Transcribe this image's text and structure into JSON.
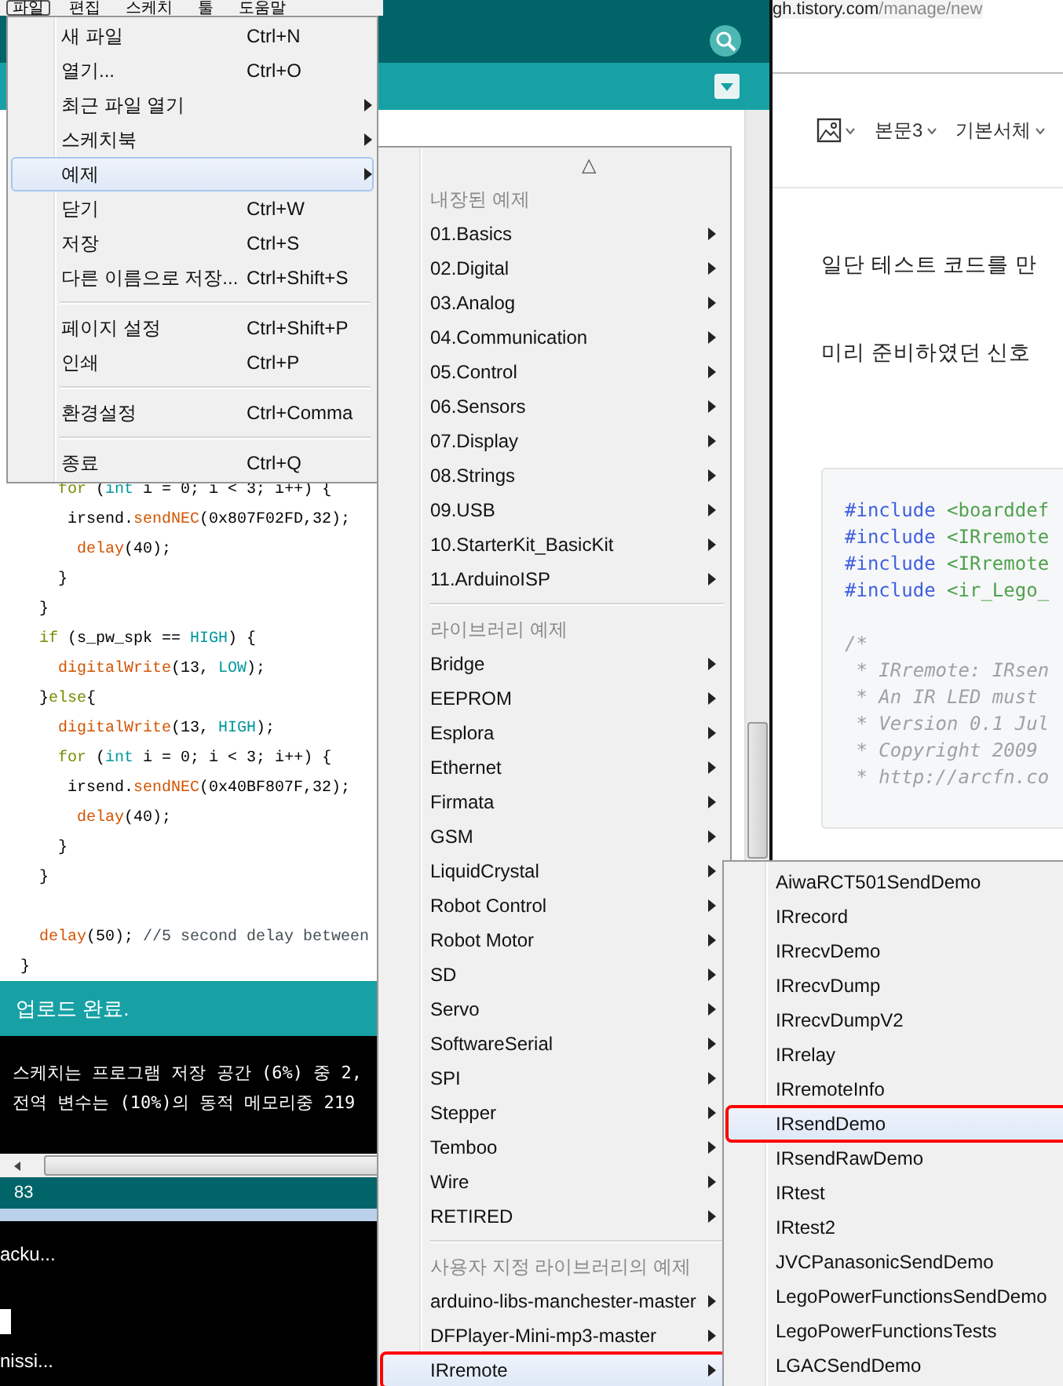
{
  "ide": {
    "menubar": [
      {
        "label": "파일",
        "selected": true
      },
      {
        "label": "편집",
        "selected": false
      },
      {
        "label": "스케치",
        "selected": false
      },
      {
        "label": "툴",
        "selected": false
      },
      {
        "label": "도움말",
        "selected": false
      }
    ],
    "code_blocks": [
      [
        [
          {
            "text": "    for",
            "kind": "keyword"
          },
          {
            "text": " ("
          },
          {
            "text": "int",
            "kind": "constant"
          },
          {
            "text": " i = 0; i < 3; i++) {"
          }
        ],
        [
          {
            "text": "     irsend."
          },
          {
            "text": "sendNEC",
            "kind": "function"
          },
          {
            "text": "(0x807F02FD,32);"
          }
        ],
        [
          {
            "text": "      delay",
            "kind": "function"
          },
          {
            "text": "(40);"
          }
        ],
        [
          {
            "text": "    }"
          }
        ],
        [
          {
            "text": "  }"
          }
        ],
        [
          {
            "text": "  if",
            "kind": "keyword"
          },
          {
            "text": " (s_pw_spk == "
          },
          {
            "text": "HIGH",
            "kind": "constant"
          },
          {
            "text": ") {"
          }
        ],
        [
          {
            "text": "    digitalWrite",
            "kind": "function"
          },
          {
            "text": "(13, "
          },
          {
            "text": "LOW",
            "kind": "constant"
          },
          {
            "text": ");"
          }
        ],
        [
          {
            "text": "  }"
          },
          {
            "text": "else",
            "kind": "keyword"
          },
          {
            "text": "{"
          }
        ],
        [
          {
            "text": "    digitalWrite",
            "kind": "function"
          },
          {
            "text": "(13, "
          },
          {
            "text": "HIGH",
            "kind": "constant"
          },
          {
            "text": ");"
          }
        ],
        [
          {
            "text": "    for",
            "kind": "keyword"
          },
          {
            "text": " ("
          },
          {
            "text": "int",
            "kind": "constant"
          },
          {
            "text": " i = 0; i < 3; i++) {"
          }
        ],
        [
          {
            "text": "     irsend."
          },
          {
            "text": "sendNEC",
            "kind": "function"
          },
          {
            "text": "(0x40BF807F,32);"
          }
        ],
        [
          {
            "text": "      delay",
            "kind": "function"
          },
          {
            "text": "(40);"
          }
        ],
        [
          {
            "text": "    }"
          }
        ],
        [
          {
            "text": "  }"
          }
        ]
      ],
      [
        [
          {
            "text": "  delay",
            "kind": "function"
          },
          {
            "text": "(50); "
          },
          {
            "text": "//5 second delay between",
            "kind": "comment"
          }
        ],
        [
          {
            "text": "}"
          }
        ]
      ]
    ],
    "status": "업로드 완료.",
    "console": [
      "스케치는 프로그램 저장 공간 (6%) 중 2,",
      "전역 변수는 (10%)의 동적 메모리중 219"
    ],
    "line_number": "83"
  },
  "terminal": {
    "lines": [
      "acku...",
      "nissi..."
    ]
  },
  "browser": {
    "url_host": "gh.tistory.com",
    "url_path": "/manage/new",
    "toolbar": [
      {
        "kind": "image"
      },
      {
        "kind": "dropdown",
        "label": "본문3"
      },
      {
        "kind": "dropdown",
        "label": "기본서체"
      }
    ],
    "paragraphs": [
      "일단 테스트 코드를 만",
      "미리 준비하였던 신호"
    ],
    "code_blocks": [
      [
        [
          {
            "text": "#include",
            "kind": "directive"
          },
          {
            "text": " <boarddef",
            "kind": "string"
          }
        ],
        [
          {
            "text": "#include",
            "kind": "directive"
          },
          {
            "text": " <IRremote",
            "kind": "string"
          }
        ],
        [
          {
            "text": "#include",
            "kind": "directive"
          },
          {
            "text": " <IRremote",
            "kind": "string"
          }
        ],
        [
          {
            "text": "#include",
            "kind": "directive"
          },
          {
            "text": " <ir_Lego_",
            "kind": "string"
          }
        ]
      ],
      [
        [
          {
            "text": "/*",
            "kind": "comment"
          }
        ],
        [
          {
            "text": " * IRremote: IRsen",
            "kind": "comment"
          }
        ],
        [
          {
            "text": " * An IR LED must",
            "kind": "comment"
          }
        ],
        [
          {
            "text": " * Version 0.1 Jul",
            "kind": "comment"
          }
        ],
        [
          {
            "text": " * Copyright 2009",
            "kind": "comment"
          }
        ],
        [
          {
            "text": " * http://arcfn.co",
            "kind": "comment"
          }
        ]
      ]
    ]
  },
  "file_menu": [
    {
      "kind": "item",
      "label": "새 파일",
      "shortcut": "Ctrl+N",
      "submenu": false,
      "selected": false
    },
    {
      "kind": "item",
      "label": "열기...",
      "shortcut": "Ctrl+O",
      "submenu": false,
      "selected": false
    },
    {
      "kind": "item",
      "label": "최근 파일 열기",
      "submenu": true,
      "selected": false
    },
    {
      "kind": "item",
      "label": "스케치북",
      "submenu": true,
      "selected": false
    },
    {
      "kind": "item",
      "label": "예제",
      "submenu": true,
      "selected": true
    },
    {
      "kind": "item",
      "label": "닫기",
      "shortcut": "Ctrl+W",
      "submenu": false,
      "selected": false
    },
    {
      "kind": "item",
      "label": "저장",
      "shortcut": "Ctrl+S",
      "submenu": false,
      "selected": false
    },
    {
      "kind": "item",
      "label": "다른 이름으로 저장...",
      "shortcut": "Ctrl+Shift+S",
      "submenu": false,
      "selected": false
    },
    {
      "kind": "separator"
    },
    {
      "kind": "item",
      "label": "페이지 설정",
      "shortcut": "Ctrl+Shift+P",
      "submenu": false,
      "selected": false
    },
    {
      "kind": "item",
      "label": "인쇄",
      "shortcut": "Ctrl+P",
      "submenu": false,
      "selected": false
    },
    {
      "kind": "separator"
    },
    {
      "kind": "item",
      "label": "환경설정",
      "shortcut": "Ctrl+Comma",
      "submenu": false,
      "selected": false
    },
    {
      "kind": "separator"
    },
    {
      "kind": "item",
      "label": "종료",
      "shortcut": "Ctrl+Q",
      "submenu": false,
      "selected": false
    }
  ],
  "examples_menu": [
    {
      "kind": "scroll",
      "label": "△"
    },
    {
      "kind": "header",
      "label": "내장된 예제"
    },
    {
      "kind": "item",
      "label": "01.Basics",
      "selected": false,
      "annotated": false
    },
    {
      "kind": "item",
      "label": "02.Digital",
      "selected": false,
      "annotated": false
    },
    {
      "kind": "item",
      "label": "03.Analog",
      "selected": false,
      "annotated": false
    },
    {
      "kind": "item",
      "label": "04.Communication",
      "selected": false,
      "annotated": false
    },
    {
      "kind": "item",
      "label": "05.Control",
      "selected": false,
      "annotated": false
    },
    {
      "kind": "item",
      "label": "06.Sensors",
      "selected": false,
      "annotated": false
    },
    {
      "kind": "item",
      "label": "07.Display",
      "selected": false,
      "annotated": false
    },
    {
      "kind": "item",
      "label": "08.Strings",
      "selected": false,
      "annotated": false
    },
    {
      "kind": "item",
      "label": "09.USB",
      "selected": false,
      "annotated": false
    },
    {
      "kind": "item",
      "label": "10.StarterKit_BasicKit",
      "selected": false,
      "annotated": false
    },
    {
      "kind": "item",
      "label": "11.ArduinoISP",
      "selected": false,
      "annotated": false
    },
    {
      "kind": "separator"
    },
    {
      "kind": "header",
      "label": "라이브러리 예제"
    },
    {
      "kind": "item",
      "label": "Bridge",
      "selected": false,
      "annotated": false
    },
    {
      "kind": "item",
      "label": "EEPROM",
      "selected": false,
      "annotated": false
    },
    {
      "kind": "item",
      "label": "Esplora",
      "selected": false,
      "annotated": false
    },
    {
      "kind": "item",
      "label": "Ethernet",
      "selected": false,
      "annotated": false
    },
    {
      "kind": "item",
      "label": "Firmata",
      "selected": false,
      "annotated": false
    },
    {
      "kind": "item",
      "label": "GSM",
      "selected": false,
      "annotated": false
    },
    {
      "kind": "item",
      "label": "LiquidCrystal",
      "selected": false,
      "annotated": false
    },
    {
      "kind": "item",
      "label": "Robot Control",
      "selected": false,
      "annotated": false
    },
    {
      "kind": "item",
      "label": "Robot Motor",
      "selected": false,
      "annotated": false
    },
    {
      "kind": "item",
      "label": "SD",
      "selected": false,
      "annotated": false
    },
    {
      "kind": "item",
      "label": "Servo",
      "selected": false,
      "annotated": false
    },
    {
      "kind": "item",
      "label": "SoftwareSerial",
      "selected": false,
      "annotated": false
    },
    {
      "kind": "item",
      "label": "SPI",
      "selected": false,
      "annotated": false
    },
    {
      "kind": "item",
      "label": "Stepper",
      "selected": false,
      "annotated": false
    },
    {
      "kind": "item",
      "label": "Temboo",
      "selected": false,
      "annotated": false
    },
    {
      "kind": "item",
      "label": "Wire",
      "selected": false,
      "annotated": false
    },
    {
      "kind": "item",
      "label": "RETIRED",
      "selected": false,
      "annotated": false
    },
    {
      "kind": "separator"
    },
    {
      "kind": "header",
      "label": "사용자 지정 라이브러리의 예제"
    },
    {
      "kind": "item",
      "label": "arduino-libs-manchester-master",
      "selected": false,
      "annotated": false
    },
    {
      "kind": "item",
      "label": "DFPlayer-Mini-mp3-master",
      "selected": false,
      "annotated": false
    },
    {
      "kind": "item",
      "label": "IRremote",
      "selected": true,
      "annotated": true
    }
  ],
  "irremote_menu": [
    {
      "label": "AiwaRCT501SendDemo",
      "selected": false,
      "annotated": false
    },
    {
      "label": "IRrecord",
      "selected": false,
      "annotated": false
    },
    {
      "label": "IRrecvDemo",
      "selected": false,
      "annotated": false
    },
    {
      "label": "IRrecvDump",
      "selected": false,
      "annotated": false
    },
    {
      "label": "IRrecvDumpV2",
      "selected": false,
      "annotated": false
    },
    {
      "label": "IRrelay",
      "selected": false,
      "annotated": false
    },
    {
      "label": "IRremoteInfo",
      "selected": false,
      "annotated": false
    },
    {
      "label": "IRsendDemo",
      "selected": true,
      "annotated": true
    },
    {
      "label": "IRsendRawDemo",
      "selected": false,
      "annotated": false
    },
    {
      "label": "IRtest",
      "selected": false,
      "annotated": false
    },
    {
      "label": "IRtest2",
      "selected": false,
      "annotated": false
    },
    {
      "label": "JVCPanasonicSendDemo",
      "selected": false,
      "annotated": false
    },
    {
      "label": "LegoPowerFunctionsSendDemo",
      "selected": false,
      "annotated": false
    },
    {
      "label": "LegoPowerFunctionsTests",
      "selected": false,
      "annotated": false
    },
    {
      "label": "LGACSendDemo",
      "selected": false,
      "annotated": false
    }
  ]
}
